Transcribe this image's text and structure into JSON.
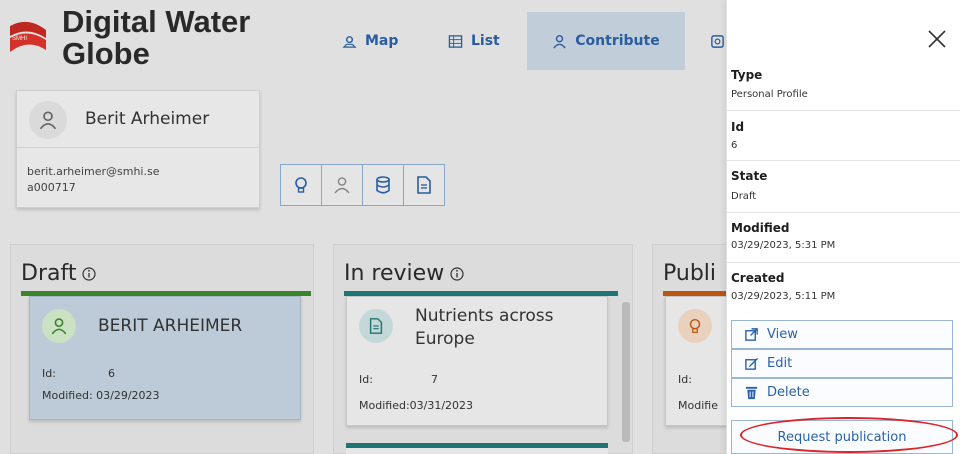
{
  "app": {
    "title": "Digital Water Globe",
    "logo_text": "SMHI"
  },
  "nav": {
    "tabs": [
      {
        "label": "Map",
        "icon": "map-icon"
      },
      {
        "label": "List",
        "icon": "list-icon"
      },
      {
        "label": "Contribute",
        "icon": "person-icon",
        "active": true
      },
      {
        "label": "",
        "icon": "partial-icon"
      }
    ]
  },
  "user": {
    "name": "Berit Arheimer",
    "email": "berit.arheimer@smhi.se",
    "code": "a000717"
  },
  "filters": [
    {
      "icon": "lightbulb-icon"
    },
    {
      "icon": "person-icon"
    },
    {
      "icon": "database-icon"
    },
    {
      "icon": "document-icon"
    }
  ],
  "columns": {
    "draft": {
      "title": "Draft",
      "bar_color": "#3e8a2e",
      "card": {
        "title": "BERIT ARHEIMER",
        "id_label": "Id:",
        "id_value": "6",
        "modified": "Modified: 03/29/2023"
      }
    },
    "review": {
      "title": "In review",
      "bar_color": "#1f7a7a",
      "card": {
        "title": "Nutrients across Europe",
        "id_label": "Id:",
        "id_value": "7",
        "modified": "Modified:03/31/2023"
      }
    },
    "published": {
      "title": "Publi",
      "bar_color": "#c55a11",
      "card": {
        "id_label": "Id:",
        "modified": "Modifie"
      }
    }
  },
  "panel": {
    "fields": [
      {
        "label": "Type",
        "value": "Personal Profile"
      },
      {
        "label": "Id",
        "value": "6"
      },
      {
        "label": "State",
        "value": "Draft"
      },
      {
        "label": "Modified",
        "value": "03/29/2023, 5:31 PM"
      },
      {
        "label": "Created",
        "value": "03/29/2023, 5:11 PM"
      }
    ],
    "actions": {
      "view": "View",
      "edit": "Edit",
      "delete": "Delete",
      "request": "Request publication"
    }
  },
  "colors": {
    "accent": "#2b61a8",
    "highlight": "#d8262a"
  }
}
